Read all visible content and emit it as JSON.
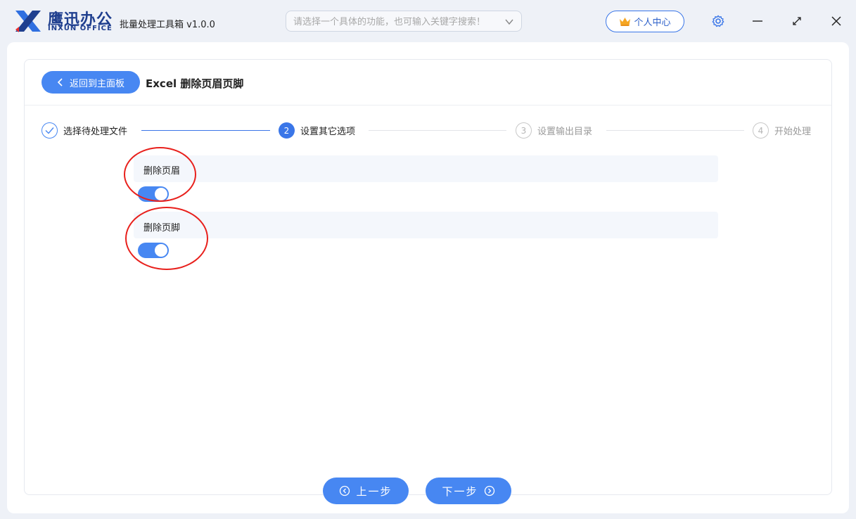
{
  "brand": {
    "name_cn": "鹰迅办公",
    "name_en": "INXUN OFFICE"
  },
  "app_title": "批量处理工具箱 v1.0.0",
  "search": {
    "placeholder": "请选择一个具体的功能，也可输入关键字搜索！"
  },
  "header": {
    "user_center_label": "个人中心"
  },
  "page": {
    "back_label": "返回到主面板",
    "title": "Excel 删除页眉页脚"
  },
  "steps": [
    {
      "number": "1",
      "label": "选择待处理文件",
      "state": "done"
    },
    {
      "number": "2",
      "label": "设置其它选项",
      "state": "active"
    },
    {
      "number": "3",
      "label": "设置输出目录",
      "state": "pending"
    },
    {
      "number": "4",
      "label": "开始处理",
      "state": "pending"
    }
  ],
  "options": [
    {
      "label": "删除页眉",
      "enabled": true
    },
    {
      "label": "删除页脚",
      "enabled": true
    }
  ],
  "footer": {
    "prev_label": "上一步",
    "next_label": "下一步"
  },
  "colors": {
    "primary": "#4787f2",
    "brand": "#1f3f8f",
    "annotation": "#e8201c",
    "option_bg": "#f4f7fc"
  },
  "icons": [
    "logo-x-icon",
    "chevron-down-icon",
    "crown-icon",
    "gear-icon",
    "minimize-icon",
    "maximize-icon",
    "close-icon",
    "chevron-left-icon",
    "check-icon",
    "circle-left-icon",
    "circle-right-icon"
  ]
}
